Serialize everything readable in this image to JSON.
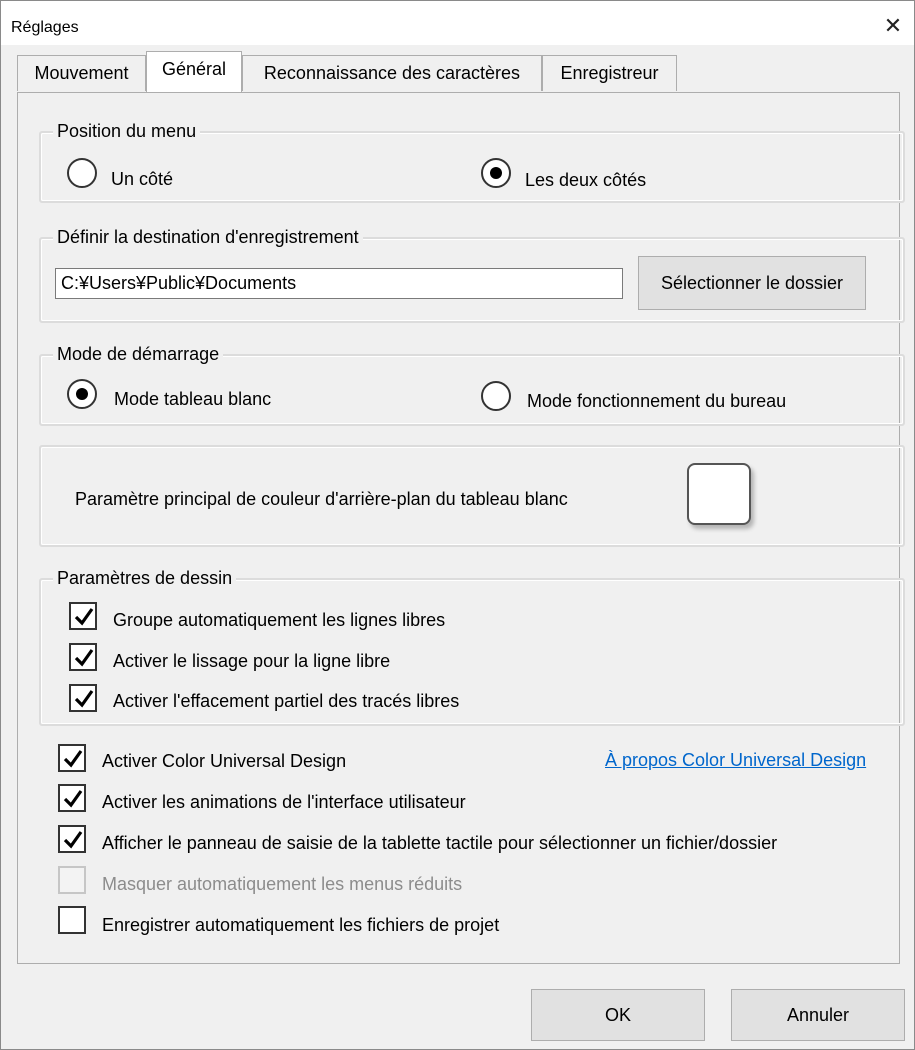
{
  "window": {
    "title": "Réglages",
    "close_glyph": "✕"
  },
  "tabs": [
    {
      "label": "Mouvement",
      "active": false
    },
    {
      "label": "Général",
      "active": true
    },
    {
      "label": "Reconnaissance des caractères",
      "active": false
    },
    {
      "label": "Enregistreur",
      "active": false
    }
  ],
  "menu_position": {
    "legend": "Position du menu",
    "options": [
      {
        "label": "Un côté",
        "selected": false
      },
      {
        "label": "Les deux côtés",
        "selected": true
      }
    ]
  },
  "save_destination": {
    "legend": "Définir la destination d'enregistrement",
    "path_value": "C:¥Users¥Public¥Documents",
    "select_button": "Sélectionner le dossier"
  },
  "startup_mode": {
    "legend": "Mode de démarrage",
    "options": [
      {
        "label": "Mode tableau blanc",
        "selected": true
      },
      {
        "label": "Mode fonctionnement du bureau",
        "selected": false
      }
    ]
  },
  "background": {
    "label": "Paramètre principal de couleur d'arrière-plan du tableau blanc",
    "swatch_color": "#ffffff"
  },
  "drawing": {
    "legend": "Paramètres de dessin",
    "options": [
      {
        "label": "Groupe automatiquement les lignes libres",
        "checked": true
      },
      {
        "label": "Activer le lissage pour la ligne libre",
        "checked": true
      },
      {
        "label": "Activer l'effacement partiel des tracés libres",
        "checked": true
      }
    ]
  },
  "general_options": [
    {
      "label": "Activer Color Universal Design",
      "checked": true,
      "enabled": true
    },
    {
      "label": "Activer les animations de l'interface utilisateur",
      "checked": true,
      "enabled": true
    },
    {
      "label": "Afficher le panneau de saisie de la tablette tactile pour sélectionner un fichier/dossier",
      "checked": true,
      "enabled": true
    },
    {
      "label": "Masquer automatiquement les menus réduits",
      "checked": false,
      "enabled": false
    },
    {
      "label": "Enregistrer automatiquement les fichiers de projet",
      "checked": false,
      "enabled": true
    }
  ],
  "cud_link": "À propos Color Universal Design",
  "footer": {
    "ok": "OK",
    "cancel": "Annuler"
  }
}
